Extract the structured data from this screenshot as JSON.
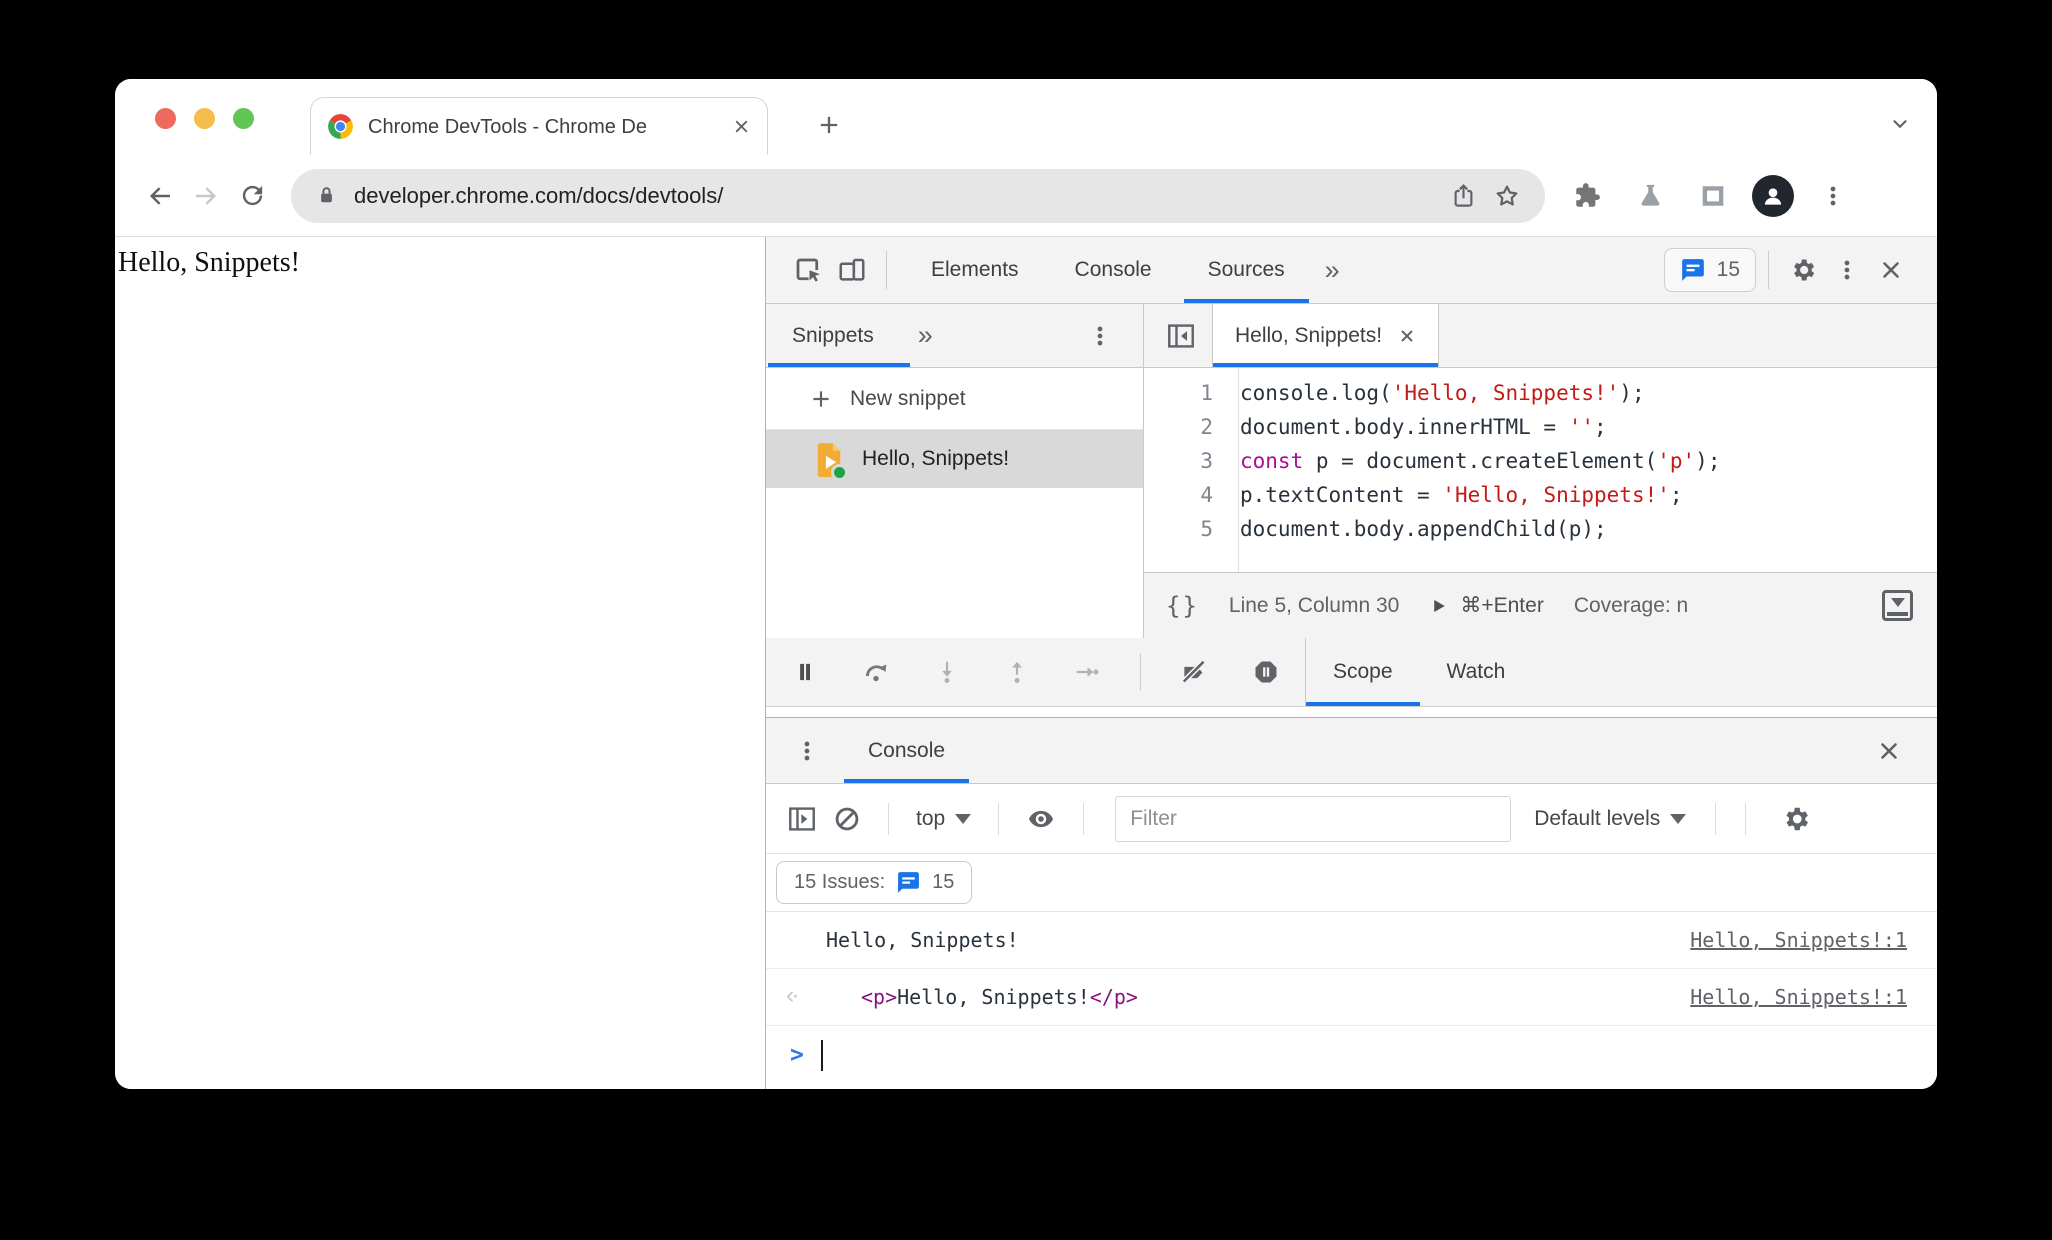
{
  "browser": {
    "tab_title": "Chrome DevTools - Chrome De",
    "url": "developer.chrome.com/docs/devtools/"
  },
  "page": {
    "text": "Hello, Snippets!"
  },
  "colors": {
    "accent_blue": "#1a73e8",
    "string_red": "#c41a16",
    "keyword_purple": "#aa0d91",
    "tag_magenta": "#881280",
    "traffic_red": "#ee6a5f",
    "traffic_yellow": "#f5bd4b",
    "traffic_green": "#62c554"
  },
  "devtools": {
    "main_tabs": [
      {
        "label": "Elements",
        "active": false
      },
      {
        "label": "Console",
        "active": false
      },
      {
        "label": "Sources",
        "active": true
      }
    ],
    "more_tabs_symbol": "»",
    "issues_count": "15",
    "snippets": {
      "tab_label": "Snippets",
      "more_symbol": "»",
      "new_snippet_label": "New snippet",
      "items": [
        {
          "label": "Hello, Snippets!"
        }
      ]
    },
    "editor": {
      "tab_label": "Hello, Snippets!",
      "code_lines": [
        [
          {
            "t": "console.log(",
            "c": "plain"
          },
          {
            "t": "'Hello, Snippets!'",
            "c": "string"
          },
          {
            "t": ");",
            "c": "plain"
          }
        ],
        [
          {
            "t": "document.body.innerHTML = ",
            "c": "plain"
          },
          {
            "t": "''",
            "c": "string"
          },
          {
            "t": ";",
            "c": "plain"
          }
        ],
        [
          {
            "t": "const",
            "c": "keyword"
          },
          {
            "t": " p = document.createElement(",
            "c": "plain"
          },
          {
            "t": "'p'",
            "c": "string"
          },
          {
            "t": ");",
            "c": "plain"
          }
        ],
        [
          {
            "t": "p.textContent = ",
            "c": "plain"
          },
          {
            "t": "'Hello, Snippets!'",
            "c": "string"
          },
          {
            "t": ";",
            "c": "plain"
          }
        ],
        [
          {
            "t": "document.body.appendChild(p);",
            "c": "plain"
          }
        ]
      ],
      "status": {
        "pretty_print_glyph": "{}",
        "line_col": "Line 5, Column 30",
        "run_shortcut": "⌘+Enter",
        "coverage": "Coverage: n"
      }
    },
    "debugger_tabs": [
      {
        "label": "Scope",
        "active": true
      },
      {
        "label": "Watch",
        "active": false
      }
    ],
    "console": {
      "tab_label": "Console",
      "context_label": "top",
      "filter_placeholder": "Filter",
      "levels_label": "Default levels",
      "issues_label": "15 Issues:",
      "issues_count": "15",
      "prompt_symbol": ">",
      "messages": [
        {
          "type": "log",
          "icon": "",
          "tokens": [
            {
              "t": "Hello, Snippets!",
              "c": "plain"
            }
          ],
          "link": "Hello, Snippets!:1"
        },
        {
          "type": "result",
          "icon": "returned-value",
          "tokens": [
            {
              "t": "<p>",
              "c": "tag"
            },
            {
              "t": "Hello, Snippets!",
              "c": "plain"
            },
            {
              "t": "</p>",
              "c": "tag"
            }
          ],
          "link": "Hello, Snippets!:1"
        }
      ]
    }
  }
}
